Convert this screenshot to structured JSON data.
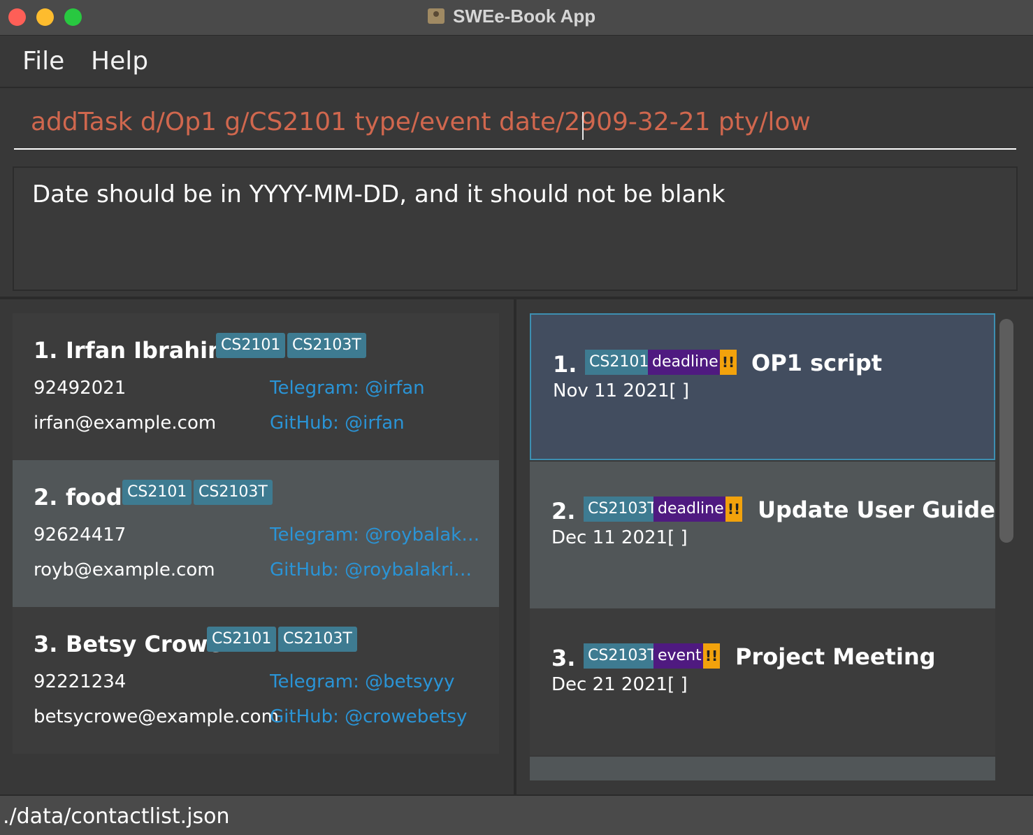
{
  "window": {
    "title": "SWEe-Book App"
  },
  "menu": {
    "file": "File",
    "help": "Help"
  },
  "command": {
    "value": "addTask d/Op1 g/CS2101 type/event date/2909-32-21 pty/low"
  },
  "result": {
    "message": "Date should be in YYYY-MM-DD, and it should not be blank"
  },
  "persons": [
    {
      "index": "1.",
      "name": "Irfan Ibrahim",
      "tags": [
        "CS2101",
        "CS2103T"
      ],
      "phone": "92492021",
      "email": "irfan@example.com",
      "telegram": "Telegram: @irfan",
      "github": "GitHub: @irfan"
    },
    {
      "index": "2.",
      "name": "food",
      "tags": [
        "CS2101",
        "CS2103T"
      ],
      "phone": "92624417",
      "email": "royb@example.com",
      "telegram": "Telegram: @roybalakrishn...",
      "github": "GitHub: @roybalakrishnan"
    },
    {
      "index": "3.",
      "name": "Betsy Crowe",
      "tags": [
        "CS2101",
        "CS2103T"
      ],
      "phone": "92221234",
      "email": "betsycrowe@example.com",
      "telegram": "Telegram: @betsyyy",
      "github": "GitHub: @crowebetsy"
    }
  ],
  "tasks": [
    {
      "index": "1.",
      "group": "CS2101",
      "type": "deadline",
      "priority": "!!",
      "description": "OP1 script",
      "date": "Nov 11 2021[ ]"
    },
    {
      "index": "2.",
      "group": "CS2103T",
      "type": "deadline",
      "priority": "!!",
      "description": "Update User Guide",
      "date": "Dec 11 2021[ ]"
    },
    {
      "index": "3.",
      "group": "CS2103T",
      "type": "event",
      "priority": "!!",
      "description": "Project Meeting",
      "date": "Dec 21 2021[ ]"
    }
  ],
  "status": {
    "file_path": "./data/contactlist.json"
  },
  "colors": {
    "tag": "#3e7b91",
    "type": "#4f1a80",
    "priority": "#f2a20c",
    "command_error": "#d0674e",
    "link": "#2a94d6"
  }
}
